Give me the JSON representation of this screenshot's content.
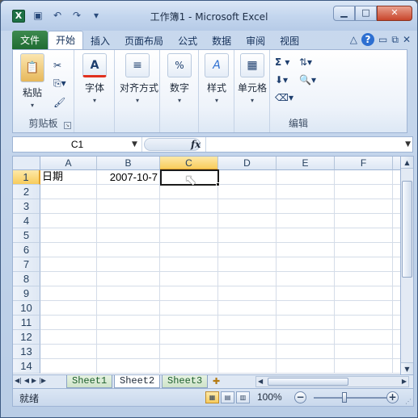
{
  "window": {
    "title": "工作簿1 - Microsoft Excel",
    "app_icon": "X"
  },
  "quick_access": {
    "save_icon": "save-icon",
    "undo_icon": "undo-icon",
    "redo_icon": "redo-icon",
    "customize_icon": "customize-qat-icon"
  },
  "ribbon_tabs": [
    "文件",
    "开始",
    "插入",
    "页面布局",
    "公式",
    "数据",
    "审阅",
    "视图"
  ],
  "ribbon_active_tab": "开始",
  "ribbon": {
    "clipboard": {
      "paste_label": "粘贴",
      "group_label": "剪贴板"
    },
    "font_label": "字体",
    "alignment_label": "对齐方式",
    "number_label": "数字",
    "number_icon_text": "%",
    "styles_label": "样式",
    "cells_label": "单元格",
    "editing_group_label": "编辑",
    "font_icon_text": "A",
    "styles_icon_text": "A",
    "sum_icon_text": "Σ"
  },
  "formula_bar": {
    "name_box": "C1",
    "fx": "fx",
    "content": ""
  },
  "sheet": {
    "columns": [
      "A",
      "B",
      "C",
      "D",
      "E",
      "F"
    ],
    "selected_column": "C",
    "rows": [
      "1",
      "2",
      "3",
      "4",
      "5",
      "6",
      "7",
      "8",
      "9",
      "10",
      "11",
      "12",
      "13",
      "14"
    ],
    "selected_row": "1",
    "cells": {
      "A1": "日期",
      "B1": "2007-10-7",
      "C1": ""
    }
  },
  "sheet_tabs": [
    "Sheet1",
    "Sheet2",
    "Sheet3"
  ],
  "active_sheet": "Sheet2",
  "status_bar": {
    "status": "就绪",
    "zoom": "100%"
  },
  "colors": {
    "file_tab": "#1e6b31",
    "selection_header": "#f8cc5c",
    "frame": "#9eb4d4"
  }
}
